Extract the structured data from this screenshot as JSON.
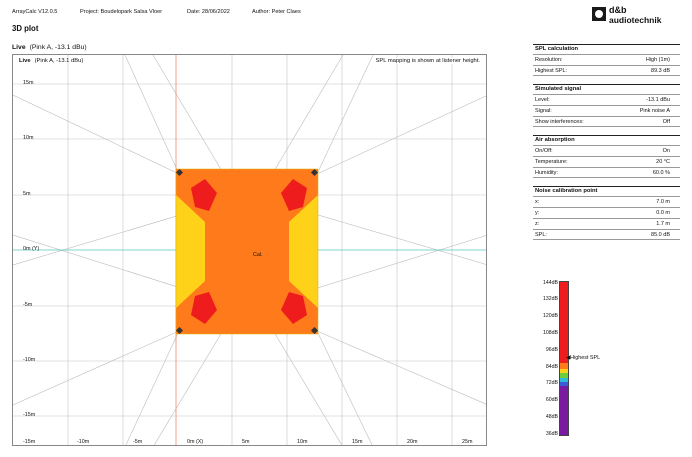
{
  "header": {
    "app": "ArrayCalc V12.0.5",
    "project": "Project: Boudelopark Salsa Vloer",
    "date": "Date: 28/06/2022",
    "author": "Author: Peter Claes",
    "logo_line1": "d&b",
    "logo_line2": "audiotechnik"
  },
  "page_title": "3D plot",
  "plot": {
    "live_label": "Live",
    "live_signal": "(Pink A, -13.1 dBu)",
    "note": "SPL mapping is shown at listener height.",
    "center_label": "Cal.",
    "y_ticks": [
      "15m",
      "10m",
      "5m",
      "0m (Y)",
      "-5m",
      "-10m",
      "-15m"
    ],
    "x_ticks": [
      "-15m",
      "-10m",
      "-5m",
      "0m (X)",
      "5m",
      "10m",
      "15m",
      "20m",
      "25m"
    ]
  },
  "panel": {
    "spl_calc": {
      "title": "SPL calculation",
      "rows": [
        {
          "label": "Resolution:",
          "value": "High (1m)"
        },
        {
          "label": "Highest SPL:",
          "value": "89.3 dB"
        }
      ]
    },
    "sim_signal": {
      "title": "Simulated signal",
      "rows": [
        {
          "label": "Level:",
          "value": "-13.1 dBu"
        },
        {
          "label": "Signal:",
          "value": "Pink noise A"
        },
        {
          "label": "Show interferences:",
          "value": "Off"
        }
      ]
    },
    "air": {
      "title": "Air absorption",
      "rows": [
        {
          "label": "On/Off:",
          "value": "On"
        },
        {
          "label": "Temperature:",
          "value": "20 °C"
        },
        {
          "label": "Humidity:",
          "value": "60.0 %"
        }
      ]
    },
    "noise_cal": {
      "title": "Noise calibration point",
      "rows": [
        {
          "label": "x:",
          "value": "7.0 m"
        },
        {
          "label": "y:",
          "value": "0.0 m"
        },
        {
          "label": "z:",
          "value": "1.7 m"
        },
        {
          "label": "SPL:",
          "value": "85.0 dB"
        }
      ]
    }
  },
  "color_scale": {
    "ticks": [
      "144dB",
      "132dB",
      "120dB",
      "108dB",
      "96dB",
      "84dB",
      "72dB",
      "60dB",
      "48dB",
      "36dB"
    ],
    "highest_label": "Highest SPL",
    "colors": {
      "max": "#ee1c1c",
      "orange": "#ff7a1a",
      "yellow": "#ffd21a",
      "green": "#6ccf3a",
      "cyan": "#2fb8d8",
      "blue": "#3a5bd8",
      "purple": "#7a1aa0"
    }
  }
}
